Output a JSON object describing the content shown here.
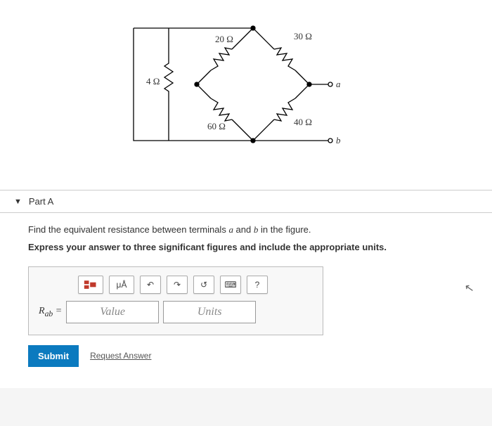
{
  "circuit": {
    "r1": "4 Ω",
    "r2": "20 Ω",
    "r3": "30 Ω",
    "r4": "60 Ω",
    "r5": "40 Ω",
    "node_a": "a",
    "node_b": "b"
  },
  "part": {
    "label": "Part A"
  },
  "instructions": {
    "line1_pre": "Find the equivalent resistance between terminals ",
    "a": "a",
    "mid": " and ",
    "b": "b",
    "line1_post": " in the figure.",
    "line2": "Express your answer to three significant figures and include the appropriate units."
  },
  "toolbar": {
    "templates": "tmpl",
    "special": "μÅ",
    "undo": "↶",
    "redo": "↷",
    "reset": "↺",
    "keyboard": "⌨",
    "help": "?"
  },
  "answer": {
    "lhs": "R",
    "sub": "ab",
    "eq": " = ",
    "value_placeholder": "Value",
    "units_placeholder": "Units"
  },
  "buttons": {
    "submit": "Submit",
    "request": "Request Answer"
  }
}
